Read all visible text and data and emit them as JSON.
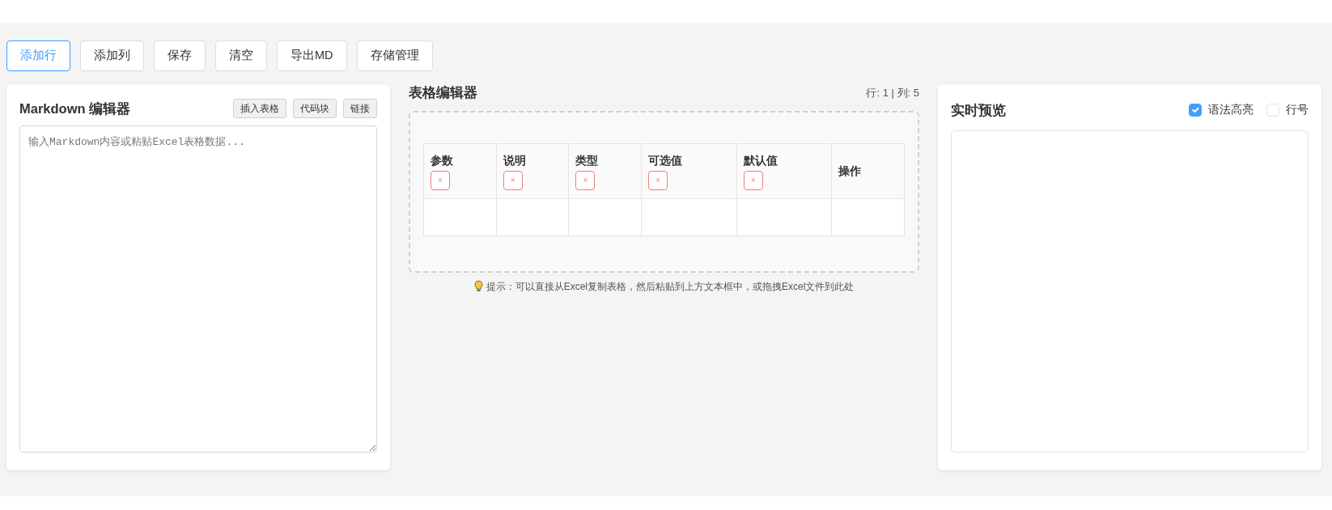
{
  "toolbar": [
    {
      "label": "添加行",
      "selected": true
    },
    {
      "label": "添加列",
      "selected": false
    },
    {
      "label": "保存",
      "selected": false
    },
    {
      "label": "清空",
      "selected": false
    },
    {
      "label": "导出MD",
      "selected": false
    },
    {
      "label": "存储管理",
      "selected": false
    }
  ],
  "editor": {
    "title": "Markdown 编辑器",
    "buttons": [
      "插入表格",
      "代码块",
      "链接"
    ],
    "placeholder": "输入Markdown内容或粘贴Excel表格数据..."
  },
  "table_editor": {
    "title": "表格编辑器",
    "counter": "行: 1 | 列: 5",
    "columns": [
      {
        "label": "参数",
        "delete": "×"
      },
      {
        "label": "说明",
        "delete": "×"
      },
      {
        "label": "类型",
        "delete": "×"
      },
      {
        "label": "可选值",
        "delete": "×"
      },
      {
        "label": "默认值",
        "delete": "×"
      },
      {
        "label": "操作"
      }
    ],
    "rows": [
      [
        "",
        "",
        "",
        "",
        "",
        ""
      ]
    ],
    "hint": "提示：可以直接从Excel复制表格，然后粘贴到上方文本框中，或拖拽Excel文件到此处"
  },
  "preview": {
    "title": "实时预览",
    "options": [
      {
        "label": "语法高亮",
        "checked": true
      },
      {
        "label": "行号",
        "checked": false
      }
    ]
  }
}
